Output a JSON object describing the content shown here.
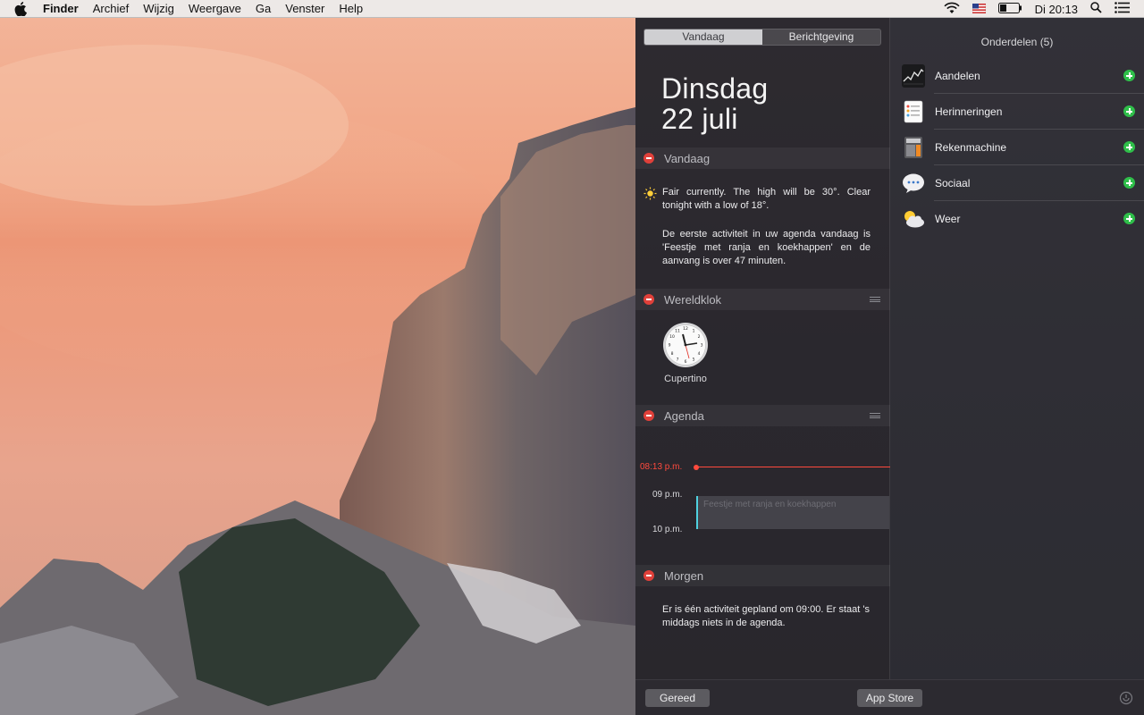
{
  "menubar": {
    "apple_icon": "apple-icon",
    "app_name": "Finder",
    "items": [
      "Archief",
      "Wijzig",
      "Weergave",
      "Ga",
      "Venster",
      "Help"
    ],
    "status_icons": [
      "wifi-icon",
      "us-flag-icon",
      "battery-icon",
      "spotlight-icon",
      "notification-center-icon"
    ],
    "clock": "Di 20:13"
  },
  "notification_center": {
    "tabs": [
      {
        "label": "Vandaag",
        "active": true
      },
      {
        "label": "Berichtgeving",
        "active": false
      }
    ],
    "date": {
      "weekday": "Dinsdag",
      "day": "22 juli"
    },
    "sections": {
      "vandaag": {
        "title": "Vandaag",
        "weather_text": "Fair currently. The high will be 30°. Clear tonight with a low of 18°.",
        "agenda_text": "De eerste activiteit in uw agenda vandaag is 'Feestje met ranja en koekhappen' en de aanvang is over 47 minuten."
      },
      "wereldklok": {
        "title": "Wereldklok",
        "city": "Cupertino"
      },
      "agenda": {
        "title": "Agenda",
        "now_label": "08:13 p.m.",
        "hours": [
          "09 p.m.",
          "10 p.m."
        ],
        "event_title": "Feestje met ranja en koekhappen"
      },
      "morgen": {
        "title": "Morgen",
        "text": "Er is één activiteit gepland om 09:00. Er staat 's middags niets in de agenda."
      }
    },
    "widgets": {
      "title": "Onderdelen (5)",
      "items": [
        {
          "label": "Aandelen",
          "icon": "stocks-icon"
        },
        {
          "label": "Herinneringen",
          "icon": "reminders-icon"
        },
        {
          "label": "Rekenmachine",
          "icon": "calculator-icon"
        },
        {
          "label": "Sociaal",
          "icon": "social-icon"
        },
        {
          "label": "Weer",
          "icon": "weather-icon"
        }
      ]
    },
    "bottom": {
      "done_label": "Gereed",
      "store_label": "App Store"
    },
    "colors": {
      "accent_red": "#ff4a3d",
      "remove_red": "#e0403a",
      "add_green": "#2fbf4a",
      "event_bar": "#4fd1e0"
    }
  }
}
